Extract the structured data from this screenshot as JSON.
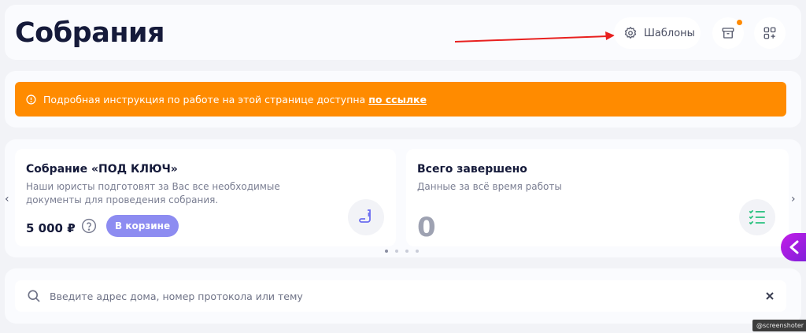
{
  "header": {
    "title": "Собрания",
    "templates_label": "Шаблоны",
    "icons": {
      "templates": "gear-icon",
      "archive": "archive-icon",
      "apps": "apps-add-icon"
    },
    "notify_color": "#ff8a00",
    "annotation_arrow_color": "#e8201f"
  },
  "notice": {
    "icon": "info-icon",
    "text": "Подробная инструкция по работе на этой странице доступна ",
    "link_text": "по ссылке",
    "color": "#ff8b00"
  },
  "cards": [
    {
      "title": "Собрание «ПОД КЛЮЧ»",
      "description": "Наши юристы подготовят за Вас все необходимые документы для проведения собрания.",
      "price": "5 000 ₽",
      "badge": "В корзине",
      "icon": "document-pen-icon"
    },
    {
      "title": "Всего завершено",
      "description": "Данные за всё время работы",
      "value": "0",
      "icon": "checklist-icon"
    }
  ],
  "carousel": {
    "dots": 4,
    "active": 0
  },
  "search": {
    "placeholder": "Введите адрес дома, номер протокола или тему",
    "value": ""
  },
  "watermark": "@screenshoter"
}
